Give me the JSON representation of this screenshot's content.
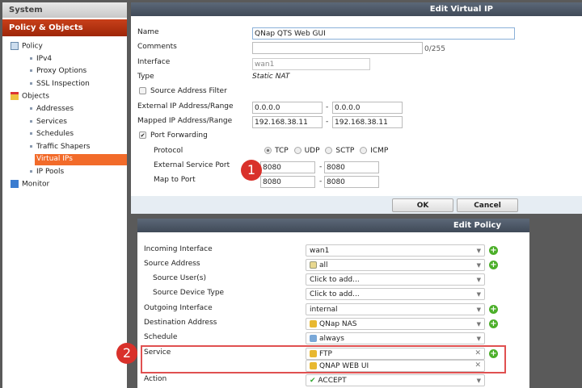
{
  "sidebar": {
    "system": "System",
    "section": "Policy & Objects",
    "policy": "Policy",
    "ipv4": "IPv4",
    "proxy": "Proxy Options",
    "ssl": "SSL Inspection",
    "objects": "Objects",
    "addresses": "Addresses",
    "services": "Services",
    "schedules": "Schedules",
    "shapers": "Traffic Shapers",
    "vips": "Virtual IPs",
    "pools": "IP Pools",
    "monitor": "Monitor"
  },
  "vip": {
    "title": "Edit Virtual IP",
    "name_label": "Name",
    "name_value": "QNap QTS Web GUI",
    "comments_label": "Comments",
    "comments_count": "0/255",
    "interface_label": "Interface",
    "interface_value": "wan1",
    "type_label": "Type",
    "type_value": "Static NAT",
    "source_filter": "Source Address Filter",
    "ext_ip_label": "External IP Address/Range",
    "ext_ip_from": "0.0.0.0",
    "ext_ip_to": "0.0.0.0",
    "mapped_label": "Mapped IP Address/Range",
    "mapped_from": "192.168.38.11",
    "mapped_to": "192.168.38.11",
    "port_fwd": "Port Forwarding",
    "protocol_label": "Protocol",
    "protocols": [
      "TCP",
      "UDP",
      "SCTP",
      "ICMP"
    ],
    "ext_port_label": "External Service Port",
    "ext_port_from": "8080",
    "ext_port_to": "8080",
    "map_port_label": "Map to Port",
    "map_port_from": "8080",
    "map_port_to": "8080",
    "ok": "OK",
    "cancel": "Cancel",
    "dash": "-"
  },
  "policy": {
    "title": "Edit Policy",
    "rows": [
      {
        "label": "Incoming Interface",
        "value": "wan1"
      },
      {
        "label": "Source Address",
        "value": "all"
      },
      {
        "label": "Source User(s)",
        "value": "Click to add..."
      },
      {
        "label": "Source Device Type",
        "value": "Click to add..."
      },
      {
        "label": "Outgoing Interface",
        "value": "internal"
      },
      {
        "label": "Destination Address",
        "value": "QNap NAS"
      },
      {
        "label": "Schedule",
        "value": "always"
      },
      {
        "label": "Service",
        "value": "FTP"
      },
      {
        "label": "",
        "value": "QNAP WEB UI"
      },
      {
        "label": "Action",
        "value": "ACCEPT"
      }
    ]
  },
  "annotations": {
    "one": "1",
    "two": "2"
  }
}
